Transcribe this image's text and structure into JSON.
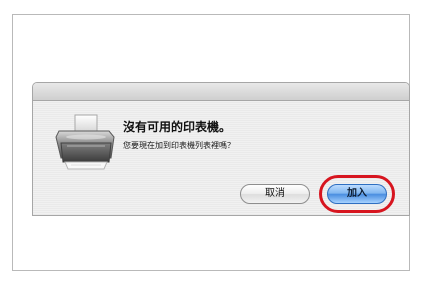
{
  "dialog": {
    "icon": "printer-icon",
    "title": "沒有可用的印表機。",
    "message": "您要現在加到印表機列表裡嗎？",
    "cancel_label": "取消",
    "add_label": "加入"
  },
  "annotation": {
    "highlight_color": "#d7151f",
    "highlighted_button": "加入"
  }
}
